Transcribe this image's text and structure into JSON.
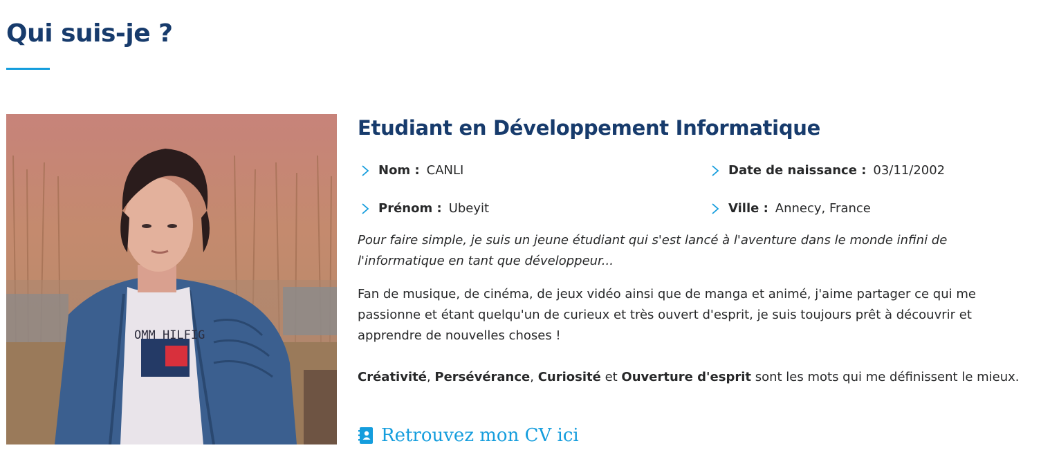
{
  "section": {
    "title": "Qui suis-je ?"
  },
  "profile": {
    "role": "Etudiant en Développement Informatique",
    "info": {
      "nom_label": "Nom :",
      "nom_value": "CANLI",
      "prenom_label": "Prénom :",
      "prenom_value": "Ubeyit",
      "naissance_label": "Date de naissance :",
      "naissance_value": "03/11/2002",
      "ville_label": "Ville :",
      "ville_value": "Annecy, France"
    },
    "intro": "Pour faire simple, je suis un jeune étudiant qui s'est lancé à l'aventure dans le monde infini de l'informatique en tant que développeur...",
    "hobbies": "Fan de musique, de cinéma, de jeux vidéo ainsi que de manga et animé, j'aime partager ce qui me passionne et étant quelqu'un de curieux et très ouvert d'esprit, je suis toujours prêt à découvrir et apprendre de nouvelles choses !",
    "traits": {
      "t1": "Créativité",
      "sep1": ", ",
      "t2": "Persévérance",
      "sep2": ", ",
      "t3": "Curiosité",
      "sep3": " et ",
      "t4": "Ouverture d'esprit",
      "tail": " sont les mots qui me définissent le mieux."
    },
    "cv_link": "Retrouvez mon CV ici",
    "photo_text": "OMM HILFIG"
  },
  "colors": {
    "heading": "#173b6c",
    "accent": "#149ddd",
    "text": "#272829"
  },
  "icons": {
    "info_bullet": "chevron-right-icon",
    "cv": "contact-book-icon"
  }
}
